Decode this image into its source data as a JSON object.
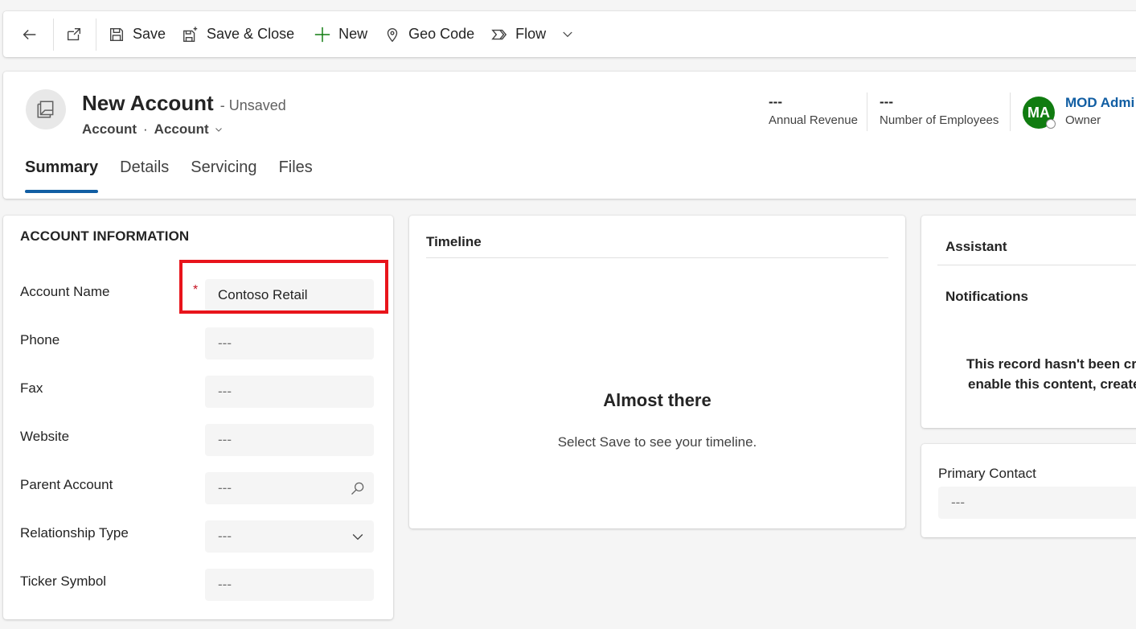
{
  "toolbar": {
    "back_icon": "arrow-left-icon",
    "popout_icon": "open-in-new-window-icon",
    "save_label": "Save",
    "save_close_label": "Save & Close",
    "new_label": "New",
    "geocode_label": "Geo Code",
    "flow_label": "Flow"
  },
  "header": {
    "title": "New Account",
    "status": "- Unsaved",
    "entity": "Account",
    "separator": "·",
    "form_selector": "Account",
    "annual_revenue_value": "---",
    "annual_revenue_label": "Annual Revenue",
    "employees_value": "---",
    "employees_label": "Number of Employees",
    "owner_initials": "MA",
    "owner_name": "MOD Admi",
    "owner_label": "Owner"
  },
  "tabs": [
    {
      "label": "Summary",
      "active": true
    },
    {
      "label": "Details",
      "active": false
    },
    {
      "label": "Servicing",
      "active": false
    },
    {
      "label": "Files",
      "active": false
    }
  ],
  "account_info": {
    "section_title": "ACCOUNT INFORMATION",
    "required_marker": "*",
    "fields": [
      {
        "label": "Account Name",
        "value": "Contoso Retail"
      },
      {
        "label": "Phone",
        "value": "---"
      },
      {
        "label": "Fax",
        "value": "---"
      },
      {
        "label": "Website",
        "value": "---"
      },
      {
        "label": "Parent Account",
        "value": "---"
      },
      {
        "label": "Relationship Type",
        "value": "---"
      },
      {
        "label": "Ticker Symbol",
        "value": "---"
      }
    ]
  },
  "timeline": {
    "title": "Timeline",
    "heading": "Almost there",
    "message": "Select Save to see your timeline."
  },
  "assistant": {
    "title": "Assistant",
    "notifications_title": "Notifications",
    "message_line1": "This record hasn't been cre",
    "message_line2": "enable this content, create"
  },
  "primary_contact": {
    "label": "Primary Contact",
    "value": "---"
  },
  "colors": {
    "accent": "#115ea3",
    "avatar_bg": "#107c10",
    "required": "#c50f1f",
    "highlight": "#e8141b"
  }
}
